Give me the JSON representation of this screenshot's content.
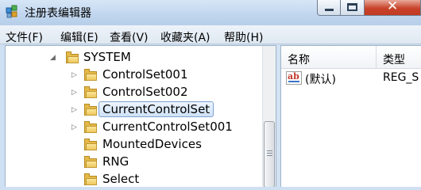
{
  "window": {
    "title": "注册表编辑器",
    "close_glyph": "✕"
  },
  "menu": [
    {
      "label": "文件(F)"
    },
    {
      "label": "编辑(E)"
    },
    {
      "label": "查看(V)"
    },
    {
      "label": "收藏夹(A)"
    },
    {
      "label": "帮助(H)"
    }
  ],
  "tree": {
    "nodes": [
      {
        "label": "SYSTEM",
        "expander": "◢",
        "expanded": true,
        "selected": false
      },
      {
        "label": "ControlSet001",
        "expander": "▷",
        "expanded": false,
        "selected": false
      },
      {
        "label": "ControlSet002",
        "expander": "▷",
        "expanded": false,
        "selected": false
      },
      {
        "label": "CurrentControlSet",
        "expander": "▷",
        "expanded": false,
        "selected": true
      },
      {
        "label": "CurrentControlSet001",
        "expander": "▷",
        "expanded": false,
        "selected": false
      },
      {
        "label": "MountedDevices",
        "expander": "",
        "expanded": false,
        "selected": false
      },
      {
        "label": "RNG",
        "expander": "",
        "expanded": false,
        "selected": false
      },
      {
        "label": "Select",
        "expander": "",
        "expanded": false,
        "selected": false
      }
    ]
  },
  "list": {
    "columns": {
      "name": "名称",
      "type": "类型"
    },
    "rows": [
      {
        "icon": "string-value-icon",
        "icon_text": "ab",
        "name": "(默认)",
        "type": "REG_S"
      }
    ]
  },
  "colors": {
    "folder": "#e5b948",
    "selection_border": "#7da2ce",
    "close_button": "#c7432a"
  }
}
